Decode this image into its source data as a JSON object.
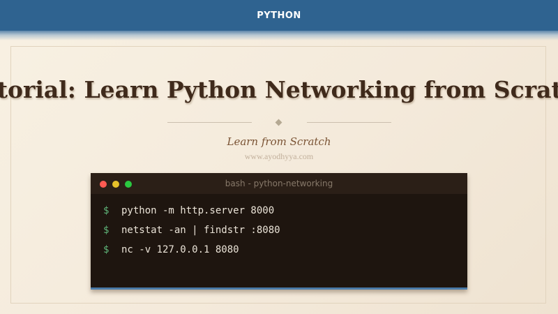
{
  "header": {
    "label": "PYTHON"
  },
  "article": {
    "title": "Tutorial: Learn Python Networking from Scratch",
    "subtitle": "Learn from Scratch",
    "site": "www.ayodhyya.com"
  },
  "terminal": {
    "title": "bash - python-networking",
    "prompt": "$",
    "commands": [
      "python -m http.server 8000",
      "netstat -an | findstr :8080",
      "nc -v 127.0.0.1 8080"
    ]
  },
  "colors": {
    "header_bg": "#2f6390",
    "title_text": "#3f2a1b",
    "terminal_bg": "#1e150f",
    "prompt": "#5fb67a"
  },
  "icons": [
    "close-dot-icon",
    "minimize-dot-icon",
    "maximize-dot-icon",
    "diamond-ornament-icon"
  ]
}
